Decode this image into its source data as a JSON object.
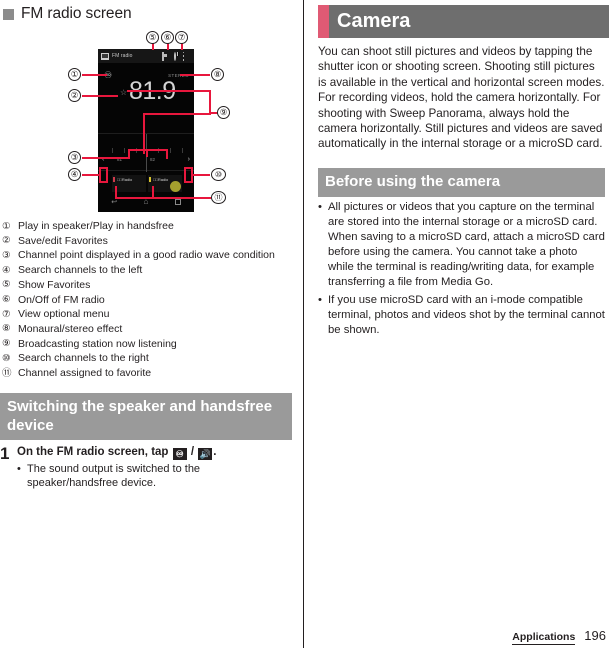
{
  "left": {
    "section_title": "FM radio screen",
    "figure": {
      "phone": {
        "app_title": "FM radio",
        "headphone_icon": "headphone-icon",
        "stereo_label": "STEREO",
        "star_glyph": "☆",
        "frequency": "81.9",
        "tuner_labels": [
          "81",
          "82"
        ],
        "arrow_left": "‹",
        "arrow_right": "›",
        "favorites": [
          {
            "name": "□□Radio"
          },
          {
            "name": "□□Radio"
          }
        ],
        "nav_back": "↩",
        "nav_home": "⌂",
        "nav_recent": "recent-apps-icon"
      },
      "callouts": [
        "①",
        "②",
        "③",
        "④",
        "⑤",
        "⑥",
        "⑦",
        "⑧",
        "⑨",
        "⑩",
        "⑪"
      ],
      "leader_color": "#e8173d"
    },
    "captions": [
      {
        "mark": "①",
        "text": "Play in speaker/Play in handsfree"
      },
      {
        "mark": "②",
        "text": "Save/edit Favorites"
      },
      {
        "mark": "③",
        "text": "Channel point displayed in a good radio wave condition"
      },
      {
        "mark": "④",
        "text": "Search channels to the left"
      },
      {
        "mark": "⑤",
        "text": "Show Favorites"
      },
      {
        "mark": "⑥",
        "text": "On/Off of FM radio"
      },
      {
        "mark": "⑦",
        "text": "View optional menu"
      },
      {
        "mark": "⑧",
        "text": "Monaural/stereo effect"
      },
      {
        "mark": "⑨",
        "text": "Broadcasting station now listening"
      },
      {
        "mark": "⑩",
        "text": "Search channels to the right"
      },
      {
        "mark": "⑪",
        "text": "Channel assigned to favorite"
      }
    ],
    "switching_section": {
      "heading": "Switching the speaker and handsfree device",
      "step_number": "1",
      "step_title_prefix": "On the FM radio screen, tap",
      "step_icon_1": "headphone-icon",
      "step_title_sep": "/",
      "step_icon_2": "speaker-icon",
      "step_title_suffix": ".",
      "bullet_dot": "•",
      "bullet_text": "The sound output is switched to the speaker/handsfree device."
    }
  },
  "right": {
    "camera_heading": "Camera",
    "camera_accent_color": "#e05a74",
    "camera_body": "You can shoot still pictures and videos by tapping the shutter icon or shooting screen. Shooting still pictures is available in the vertical and horizontal screen modes. For recording videos, hold the camera horizontally. For shooting with Sweep Panorama, always hold the camera horizontally. Still pictures and videos are saved automatically in the internal storage or a microSD card.",
    "before_heading": "Before using the camera",
    "bullet_dot": "•",
    "before_bullets": [
      "All pictures or videos that you capture on the terminal are stored into the internal storage or a microSD card. When saving to a microSD card, attach a microSD card before using the camera. You cannot take a photo while the terminal is reading/writing data, for example transferring a file from Media Go.",
      "If you use microSD card with an i-mode compatible terminal, photos and videos shot by the terminal cannot be shown."
    ]
  },
  "footer": {
    "label": "Applications",
    "page": "196"
  }
}
